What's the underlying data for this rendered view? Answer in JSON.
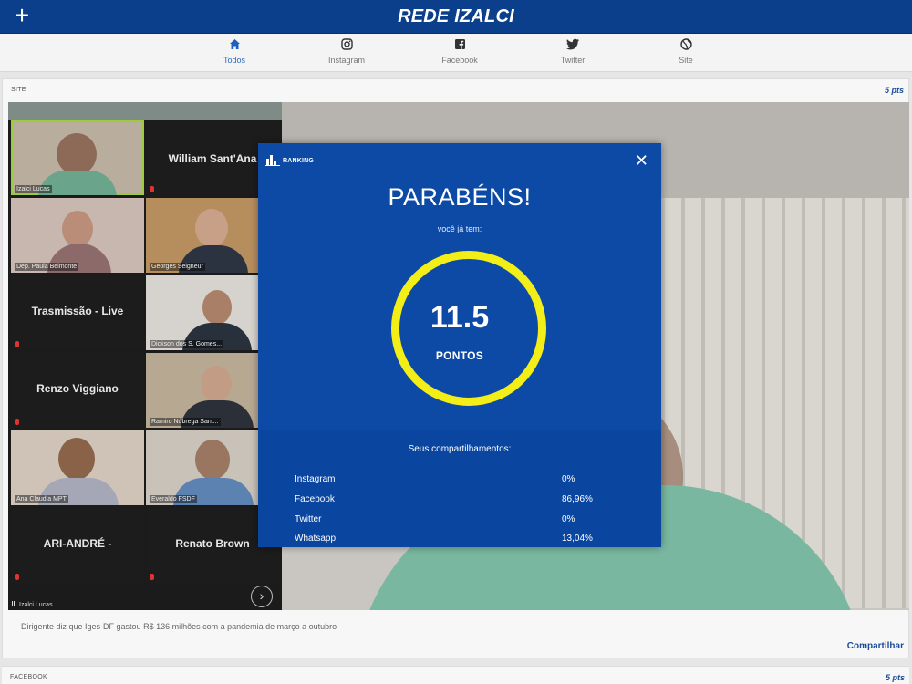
{
  "header": {
    "title": "REDE IZALCI"
  },
  "tabs": [
    {
      "label": "Todos",
      "icon": "home-icon",
      "active": true
    },
    {
      "label": "Instagram",
      "icon": "instagram-icon"
    },
    {
      "label": "Facebook",
      "icon": "facebook-icon"
    },
    {
      "label": "Twitter",
      "icon": "twitter-icon"
    },
    {
      "label": "Site",
      "icon": "globe-icon"
    }
  ],
  "post": {
    "source": "SITE",
    "points": "5 pts",
    "caption": "Dirigente diz que Iges-DF gastou R$ 136 milhões com a pandemia de março a outubro",
    "share": "Compartilhar",
    "participants": [
      {
        "name": "Izalci Lucas"
      },
      {
        "name": "William Sant'Ana"
      },
      {
        "name": "Dep. Paula Belmonte"
      },
      {
        "name": "Georges Seigneur"
      },
      {
        "name": "Trasmissão - Live"
      },
      {
        "name": "Dickson dos S. Gomes..."
      },
      {
        "name": "Renzo Viggiano"
      },
      {
        "name": "Ramiro Nóbrega Sant..."
      },
      {
        "name": "Ana Claudia MPT"
      },
      {
        "name": "Everaldo FSDF"
      },
      {
        "name": "ARI-ANDRÉ -"
      },
      {
        "name": "Renato Brown"
      }
    ],
    "speaker": "Izalci Lucas"
  },
  "next_post": {
    "source": "FACEBOOK",
    "points": "5 pts"
  },
  "modal": {
    "header": "RANKING",
    "title": "PARABÉNS!",
    "subtitle": "você já tem:",
    "score": "11.5",
    "score_unit": "PONTOS",
    "shares_title": "Seus compartilhamentos:",
    "shares": [
      {
        "label": "Instagram",
        "value": "0%"
      },
      {
        "label": "Facebook",
        "value": "86,96%"
      },
      {
        "label": "Twitter",
        "value": "0%"
      },
      {
        "label": "Whatsapp",
        "value": "13,04%"
      }
    ],
    "colors": {
      "background": "#0c4aa6",
      "ring": "#f3ee17"
    }
  }
}
